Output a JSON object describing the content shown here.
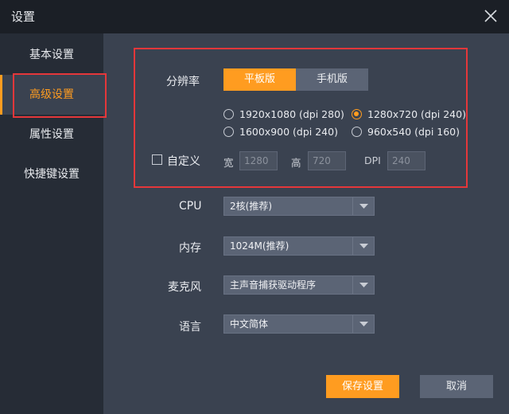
{
  "window": {
    "title": "设置"
  },
  "sidebar": {
    "items": [
      {
        "label": "基本设置"
      },
      {
        "label": "高级设置"
      },
      {
        "label": "属性设置"
      },
      {
        "label": "快捷键设置"
      }
    ],
    "active_index": 1
  },
  "resolution": {
    "label": "分辨率",
    "mode_tabs": [
      {
        "label": "平板版",
        "selected": true
      },
      {
        "label": "手机版",
        "selected": false
      }
    ],
    "options": [
      {
        "label": "1920x1080 (dpi 280)",
        "checked": false
      },
      {
        "label": "1280x720 (dpi 240)",
        "checked": true
      },
      {
        "label": "1600x900 (dpi 240)",
        "checked": false
      },
      {
        "label": "960x540 (dpi 160)",
        "checked": false
      }
    ],
    "custom": {
      "label": "自定义",
      "checked": false,
      "width_label": "宽",
      "width_value": "1280",
      "height_label": "高",
      "height_value": "720",
      "dpi_label": "DPI",
      "dpi_value": "240"
    }
  },
  "cpu": {
    "label": "CPU",
    "value": "2核(推荐)"
  },
  "memory": {
    "label": "内存",
    "value": "1024M(推荐)"
  },
  "microphone": {
    "label": "麦克风",
    "value": "主声音捕获驱动程序"
  },
  "language": {
    "label": "语言",
    "value": "中文简体"
  },
  "footer": {
    "save_label": "保存设置",
    "cancel_label": "取消"
  },
  "colors": {
    "accent": "#ff9c20",
    "highlight": "#e5373a",
    "panel": "#3a4250",
    "sidebar": "#262c36",
    "titlebar": "#1b1f26"
  },
  "icons": {
    "close": "close-icon",
    "dropdown": "chevron-down-icon"
  }
}
